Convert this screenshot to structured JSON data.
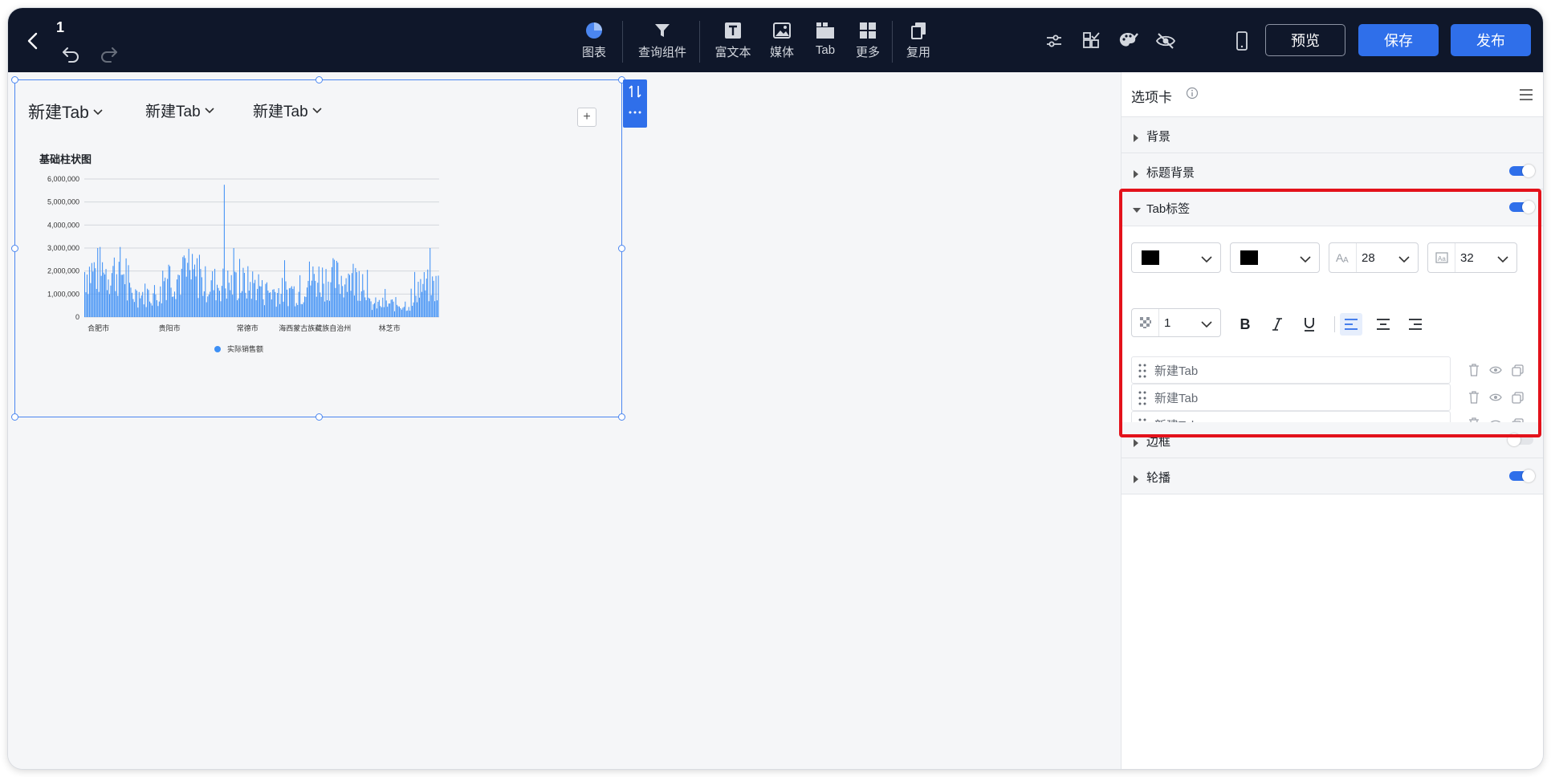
{
  "topbar": {
    "title": "1",
    "tools": [
      {
        "label": "图表",
        "icon": "pie-chart-icon"
      },
      {
        "label": "查询组件",
        "icon": "filter-icon"
      },
      {
        "label": "富文本",
        "icon": "text-box-icon"
      },
      {
        "label": "媒体",
        "icon": "image-icon"
      },
      {
        "label": "Tab",
        "icon": "tab-icon"
      },
      {
        "label": "更多",
        "icon": "grid-icon"
      },
      {
        "label": "复用",
        "icon": "copy-icon"
      }
    ],
    "right_icons": [
      "sliders-icon",
      "checklist-icon",
      "palette-icon",
      "eye-off-icon",
      "mobile-icon"
    ],
    "preview_label": "预览",
    "save_label": "保存",
    "publish_label": "发布",
    "accent_color": "#2f6fea",
    "bar_color": "#0f172a"
  },
  "canvas": {
    "tabs": [
      "新建Tab",
      "新建Tab",
      "新建Tab"
    ],
    "add_tab": "+"
  },
  "chart_data": {
    "type": "bar",
    "title": "基础柱状图",
    "xlabel": "",
    "ylabel": "",
    "ylim": [
      0,
      6000000
    ],
    "yticks": [
      "6,000,000",
      "5,000,000",
      "4,000,000",
      "3,000,000",
      "2,000,000",
      "1,000,000",
      "0"
    ],
    "x_tick_labels": [
      "合肥市",
      "贵阳市",
      "常德市",
      "海西蒙古族藏族自治州",
      "林芝市"
    ],
    "series": [
      {
        "name": "实际销售额",
        "color": "#3d8ff5"
      }
    ],
    "legend": "bottom-center",
    "approx_peak_value": 5750000,
    "approx_typical_range": [
      500000,
      3000000
    ],
    "grid": true
  },
  "panel": {
    "title": "选项卡",
    "sections": {
      "background": {
        "label": "背景"
      },
      "title_background": {
        "label": "标题背景",
        "enabled": true
      },
      "tab_labels": {
        "label": "Tab标签",
        "enabled": true
      },
      "border": {
        "label": "边框",
        "enabled": false
      },
      "carousel": {
        "label": "轮播",
        "enabled": true
      }
    },
    "font_color": "#000000",
    "active_font_color": "#000000",
    "font_size": "28",
    "active_font_size": "32",
    "letter_spacing": "1",
    "tab_items": [
      "新建Tab",
      "新建Tab",
      "新建Tab"
    ],
    "tab_item_placeholder": "新建Tab"
  }
}
